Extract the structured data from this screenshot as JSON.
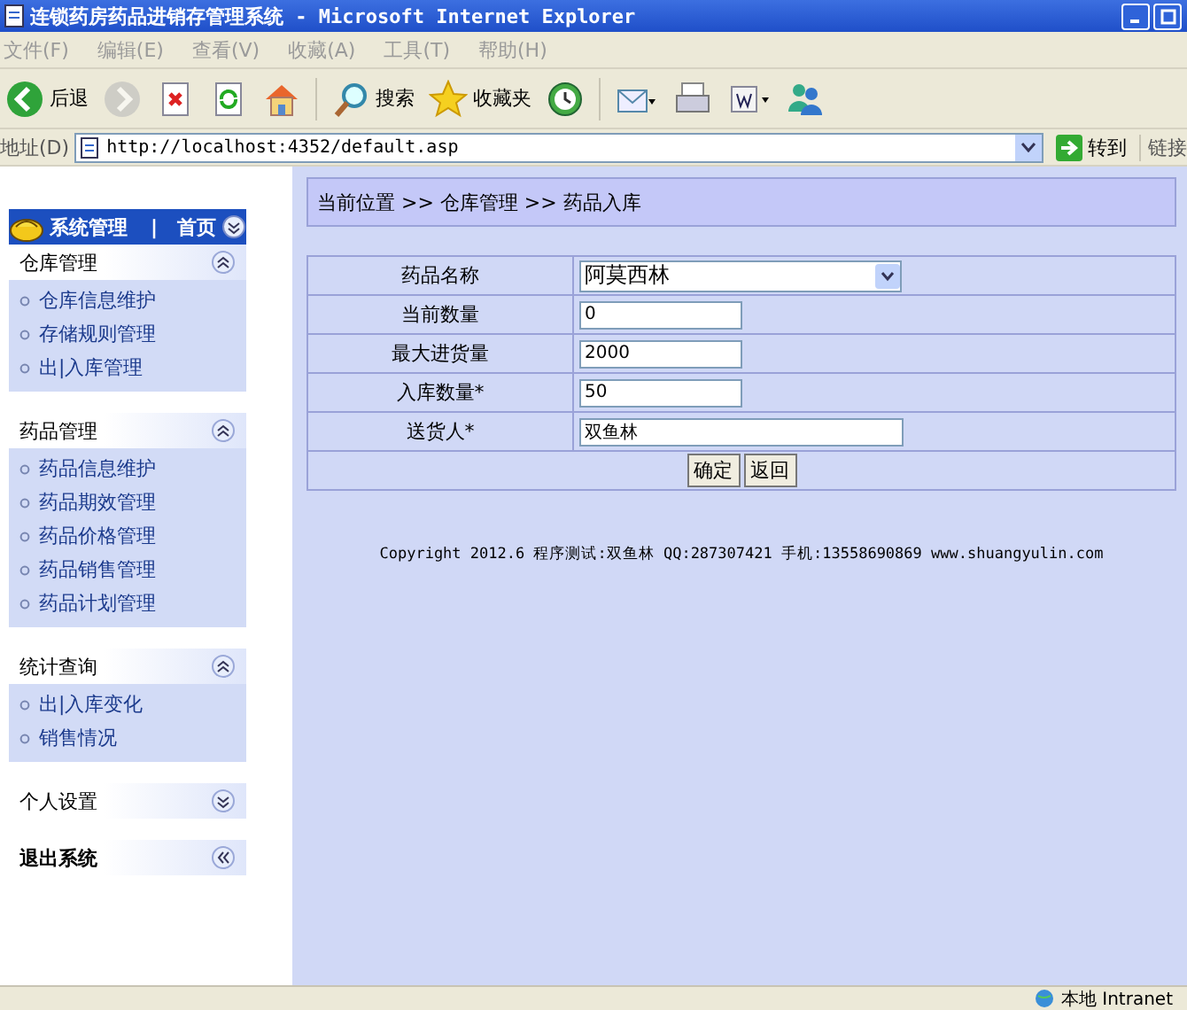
{
  "window": {
    "title": "连锁药房药品进销存管理系统 - Microsoft Internet Explorer"
  },
  "menu": [
    "文件(F)",
    "编辑(E)",
    "查看(V)",
    "收藏(A)",
    "工具(T)",
    "帮助(H)"
  ],
  "toolbar": [
    {
      "kind": "back",
      "label": "后退",
      "disabled": false
    },
    {
      "kind": "forward",
      "disabled": true
    },
    {
      "kind": "stop",
      "disabled": false
    },
    {
      "kind": "refresh",
      "disabled": false
    },
    {
      "kind": "home",
      "disabled": false
    },
    {
      "kind": "search",
      "label": "搜索",
      "disabled": false
    },
    {
      "kind": "favorites",
      "label": "收藏夹",
      "disabled": false
    },
    {
      "kind": "history",
      "disabled": false
    },
    {
      "kind": "mail",
      "disabled": false
    },
    {
      "kind": "print",
      "disabled": false
    },
    {
      "kind": "edit",
      "disabled": false
    },
    {
      "kind": "messenger",
      "disabled": false
    }
  ],
  "address": {
    "label": "地址(D)",
    "value": "http://localhost:4352/default.asp",
    "go": "转到",
    "links": "链接"
  },
  "sidebar": {
    "header": {
      "title": "系统管理",
      "separator": "|",
      "home": "首页"
    },
    "groups": [
      {
        "kind": "group",
        "title": "仓库管理",
        "expanded": true,
        "items": [
          "仓库信息维护",
          "存储规则管理",
          "出|入库管理"
        ]
      },
      {
        "kind": "group",
        "title": "药品管理",
        "expanded": true,
        "items": [
          "药品信息维护",
          "药品期效管理",
          "药品价格管理",
          "药品销售管理",
          "药品计划管理"
        ]
      },
      {
        "kind": "group",
        "title": "统计查询",
        "expanded": true,
        "items": [
          "出|入库变化",
          "销售情况"
        ]
      },
      {
        "kind": "group",
        "title": "个人设置",
        "expanded": false
      },
      {
        "kind": "exit",
        "title": "退出系统"
      }
    ]
  },
  "breadcrumb": "当前位置 >> 仓库管理 >> 药品入库",
  "form": {
    "rows": [
      {
        "label": "药品名称",
        "kind": "select",
        "value": "阿莫西林"
      },
      {
        "label": "当前数量",
        "kind": "input",
        "value": "0"
      },
      {
        "label": "最大进货量",
        "kind": "input",
        "value": "2000"
      },
      {
        "label": "入库数量*",
        "kind": "input",
        "value": "50"
      },
      {
        "label": "送货人*",
        "kind": "wide",
        "value": "双鱼林"
      }
    ],
    "buttons": [
      "确定",
      "返回"
    ]
  },
  "footer": "Copyright 2012.6 程序测试:双鱼林 QQ:287307421 手机:13558690869 www.shuangyulin.com",
  "status_bar": {
    "zone": "本地 Intranet"
  }
}
